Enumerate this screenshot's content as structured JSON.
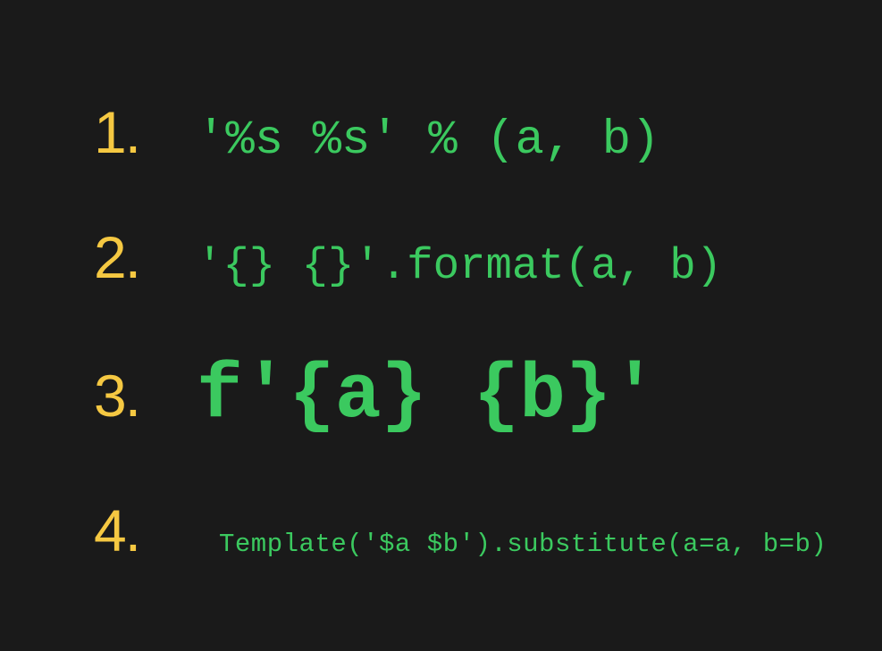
{
  "lines": [
    {
      "number": "1.",
      "code": "'%s %s' % (a, b)"
    },
    {
      "number": "2.",
      "code": "'{} {}'.format(a, b)"
    },
    {
      "number": "3.",
      "code": "f'{a} {b}'"
    },
    {
      "number": "4.",
      "code": "Template('$a $b').substitute(a=a, b=b)"
    }
  ]
}
